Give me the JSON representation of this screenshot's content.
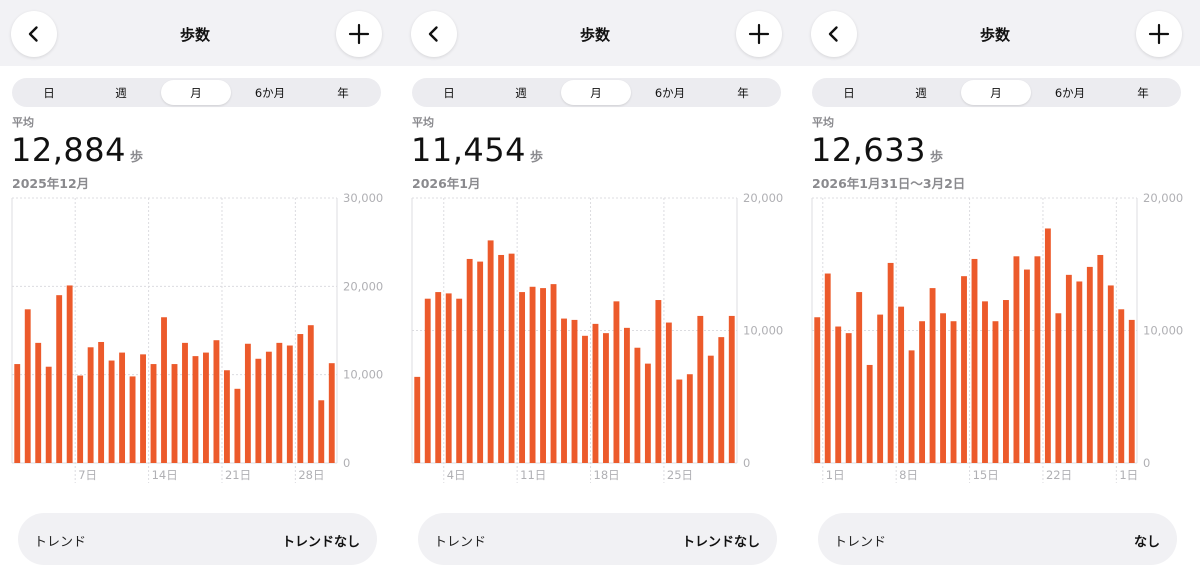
{
  "colors": {
    "bar": "#ec5a2b",
    "header_bg": "#f2f2f5",
    "axis_text": "#b0b0b4",
    "grid": "#dcdce0"
  },
  "panels": [
    {
      "header": {
        "title": "歩数",
        "back_icon": "chevron-left-icon",
        "add_icon": "plus-icon"
      },
      "segments": [
        "日",
        "週",
        "月",
        "6か月",
        "年"
      ],
      "active_segment": 2,
      "average_label": "平均",
      "average_value": "12,884",
      "unit": "歩",
      "date_range": "2025年12月",
      "trend": {
        "label": "トレンド",
        "value": "トレンドなし"
      },
      "chart_data": {
        "type": "bar",
        "ylim": [
          0,
          30000
        ],
        "yticks": [
          "0",
          "10,000",
          "20,000",
          "30,000"
        ],
        "ytick_values": [
          0,
          10000,
          20000,
          30000
        ],
        "xtick_labels": [
          "7日",
          "14日",
          "21日",
          "28日"
        ],
        "xtick_index": [
          6,
          13,
          20,
          27
        ],
        "values": [
          11200,
          17400,
          13600,
          10900,
          19000,
          20100,
          9900,
          13100,
          13700,
          11600,
          12500,
          9800,
          12300,
          11200,
          16500,
          11200,
          13600,
          12100,
          12500,
          13900,
          10500,
          8400,
          13500,
          11800,
          12600,
          13600,
          13300,
          14600,
          15600,
          7100,
          11300
        ]
      }
    },
    {
      "header": {
        "title": "歩数",
        "back_icon": "chevron-left-icon",
        "add_icon": "plus-icon"
      },
      "segments": [
        "日",
        "週",
        "月",
        "6か月",
        "年"
      ],
      "active_segment": 2,
      "average_label": "平均",
      "average_value": "11,454",
      "unit": "歩",
      "date_range": "2026年1月",
      "trend": {
        "label": "トレンド",
        "value": "トレンドなし"
      },
      "chart_data": {
        "type": "bar",
        "ylim": [
          0,
          20000
        ],
        "yticks": [
          "0",
          "10,000",
          "20,000"
        ],
        "ytick_values": [
          0,
          10000,
          20000
        ],
        "xtick_labels": [
          "4日",
          "11日",
          "18日",
          "25日"
        ],
        "xtick_index": [
          3,
          10,
          17,
          24
        ],
        "values": [
          6500,
          12400,
          12900,
          12800,
          12400,
          15400,
          15200,
          16800,
          15700,
          15800,
          12900,
          13300,
          13200,
          13500,
          10900,
          10800,
          9600,
          10500,
          9800,
          12200,
          10200,
          8700,
          7500,
          12300,
          10600,
          6300,
          6700,
          11100,
          8100,
          9500,
          11100
        ]
      }
    },
    {
      "header": {
        "title": "歩数",
        "back_icon": "chevron-left-icon",
        "add_icon": "plus-icon"
      },
      "segments": [
        "日",
        "週",
        "月",
        "6か月",
        "年"
      ],
      "active_segment": 2,
      "average_label": "平均",
      "average_value": "12,633",
      "unit": "歩",
      "date_range": "2026年1月31日〜3月2日",
      "trend": {
        "label": "トレンド",
        "value": "なし"
      },
      "chart_data": {
        "type": "bar",
        "ylim": [
          0,
          20000
        ],
        "yticks": [
          "0",
          "10,000",
          "20,000"
        ],
        "ytick_values": [
          0,
          10000,
          20000
        ],
        "xtick_labels": [
          "1日",
          "8日",
          "15日",
          "22日",
          "1日"
        ],
        "xtick_index": [
          1,
          8,
          15,
          22,
          29
        ],
        "values": [
          11000,
          14300,
          10300,
          9800,
          12900,
          7400,
          11200,
          15100,
          11800,
          8500,
          10700,
          13200,
          11300,
          10700,
          14100,
          15400,
          12200,
          10700,
          12300,
          15600,
          14600,
          15600,
          17700,
          11300,
          14200,
          13700,
          14800,
          15700,
          13400,
          11600,
          10800
        ]
      }
    }
  ]
}
